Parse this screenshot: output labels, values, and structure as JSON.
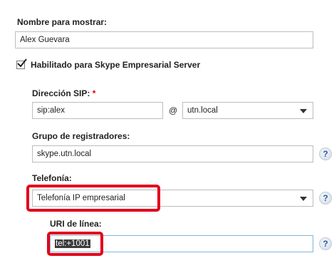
{
  "display_name": {
    "label": "Nombre para mostrar:",
    "value": "Alex Guevara"
  },
  "enabled": {
    "label": "Habilitado para Skype Empresarial Server",
    "checked": true
  },
  "sip": {
    "label": "Dirección SIP:",
    "required_mark": "*",
    "value": "sip:alex",
    "at": "@",
    "domain": "utn.local"
  },
  "registrar": {
    "label": "Grupo de registradores:",
    "value": "skype.utn.local",
    "help": "?"
  },
  "telephony": {
    "label": "Telefonía:",
    "value": "Telefonía IP empresarial",
    "help": "?"
  },
  "line_uri": {
    "label": "URI de línea:",
    "value": "tel:+1001",
    "help": "?"
  },
  "colors": {
    "highlight": "#e3001b",
    "selection_bg": "#3b3b3b",
    "active_border": "#7fb7d9"
  },
  "icons": [
    "check-icon",
    "chevron-down-icon",
    "help-icon"
  ]
}
